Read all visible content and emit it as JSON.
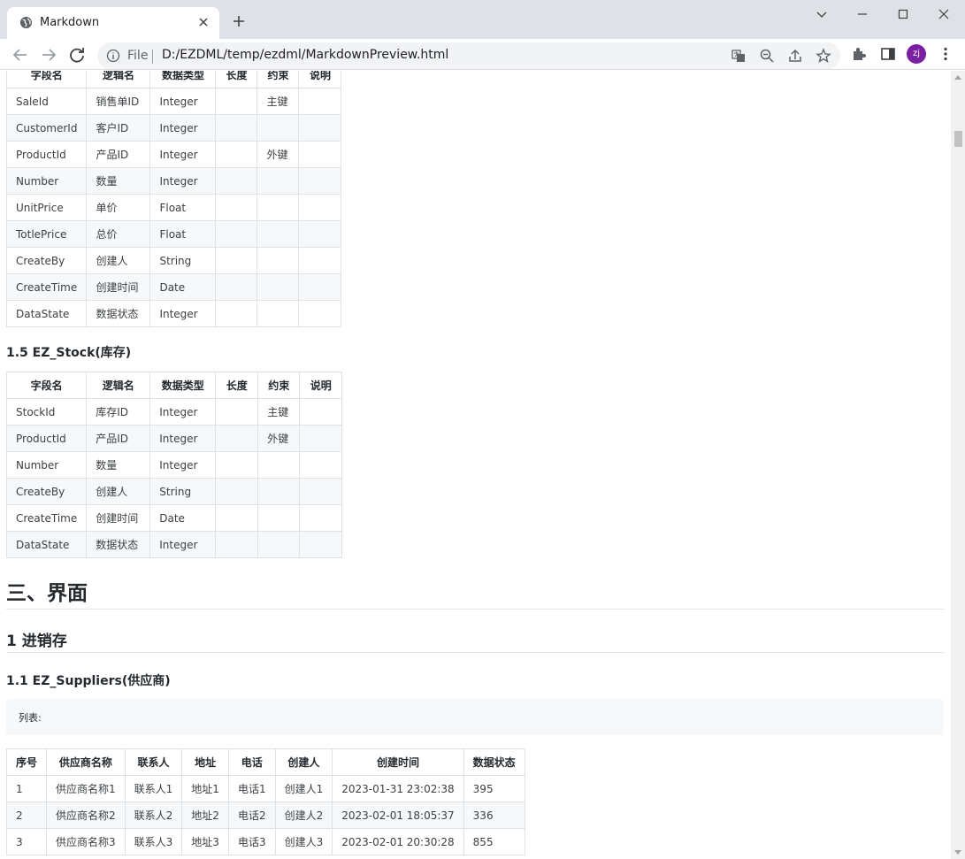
{
  "browser": {
    "tab_title": "Markdown",
    "scheme": "File",
    "url": "D:/EZDML/temp/ezdml/MarkdownPreview.html",
    "profile_initials": "zj",
    "profile_color": "#7b1fa2"
  },
  "table_sales": {
    "headers": [
      "字段名",
      "逻辑名",
      "数据类型",
      "长度",
      "约束",
      "说明"
    ],
    "rows": [
      [
        "SaleId",
        "销售单ID",
        "Integer",
        "",
        "主键",
        ""
      ],
      [
        "CustomerId",
        "客户ID",
        "Integer",
        "",
        "",
        ""
      ],
      [
        "ProductId",
        "产品ID",
        "Integer",
        "",
        "外键",
        ""
      ],
      [
        "Number",
        "数量",
        "Integer",
        "",
        "",
        ""
      ],
      [
        "UnitPrice",
        "单价",
        "Float",
        "",
        "",
        ""
      ],
      [
        "TotlePrice",
        "总价",
        "Float",
        "",
        "",
        ""
      ],
      [
        "CreateBy",
        "创建人",
        "String",
        "",
        "",
        ""
      ],
      [
        "CreateTime",
        "创建时间",
        "Date",
        "",
        "",
        ""
      ],
      [
        "DataState",
        "数据状态",
        "Integer",
        "",
        "",
        ""
      ]
    ]
  },
  "section_stock_title": "1.5 EZ_Stock(库存)",
  "table_stock": {
    "headers": [
      "字段名",
      "逻辑名",
      "数据类型",
      "长度",
      "约束",
      "说明"
    ],
    "rows": [
      [
        "StockId",
        "库存ID",
        "Integer",
        "",
        "主键",
        ""
      ],
      [
        "ProductId",
        "产品ID",
        "Integer",
        "",
        "外键",
        ""
      ],
      [
        "Number",
        "数量",
        "Integer",
        "",
        "",
        ""
      ],
      [
        "CreateBy",
        "创建人",
        "String",
        "",
        "",
        ""
      ],
      [
        "CreateTime",
        "创建时间",
        "Date",
        "",
        "",
        ""
      ],
      [
        "DataState",
        "数据状态",
        "Integer",
        "",
        "",
        ""
      ]
    ]
  },
  "heading_ui": "三、界面",
  "heading_inventory": "1 进销存",
  "heading_suppliers": "1.1 EZ_Suppliers(供应商)",
  "code_list_label": "列表:",
  "table_suppliers": {
    "headers": [
      "序号",
      "供应商名称",
      "联系人",
      "地址",
      "电话",
      "创建人",
      "创建时间",
      "数据状态"
    ],
    "rows": [
      [
        "1",
        "供应商名称1",
        "联系人1",
        "地址1",
        "电话1",
        "创建人1",
        "2023-01-31 23:02:38",
        "395"
      ],
      [
        "2",
        "供应商名称2",
        "联系人2",
        "地址2",
        "电话2",
        "创建人2",
        "2023-02-01 18:05:37",
        "336"
      ],
      [
        "3",
        "供应商名称3",
        "联系人3",
        "地址3",
        "电话3",
        "创建人3",
        "2023-02-01 20:30:28",
        "855"
      ]
    ]
  }
}
